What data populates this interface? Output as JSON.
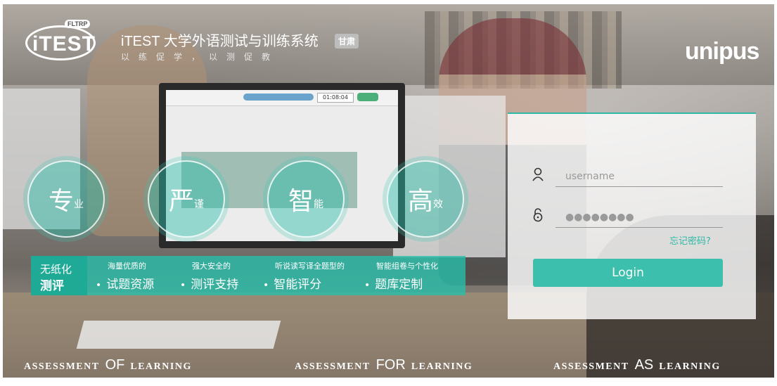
{
  "header": {
    "logo_word": "iTEST",
    "logo_tag": "FLTRP",
    "title": "iTEST 大学外语测试与训练系统",
    "region_badge": "甘肃",
    "slogan": "以练促学，以测促教",
    "brand": "unipus"
  },
  "monitor": {
    "timer": "01:08:04"
  },
  "circles": [
    {
      "big": "专",
      "small": "业"
    },
    {
      "big": "严",
      "small": "谨"
    },
    {
      "big": "智",
      "small": "能"
    },
    {
      "big": "高",
      "small": "效"
    }
  ],
  "feature_bar": {
    "lead_line1": "无纸化",
    "lead_line2": "测评",
    "items": [
      {
        "sub": "海量优质的",
        "main": "试题资源"
      },
      {
        "sub": "强大安全的",
        "main": "测评支持"
      },
      {
        "sub": "听说读写译全题型的",
        "main": "智能评分"
      },
      {
        "sub": "智能组卷与个性化",
        "main": "题库定制"
      }
    ]
  },
  "login": {
    "username_placeholder": "username",
    "password_placeholder": "●●●●●●●●",
    "forgot": "忘记密码?",
    "button": "Login"
  },
  "footer": {
    "slogans": [
      {
        "pre": "ASSESSMENT",
        "key": "OF",
        "post": "LEARNING"
      },
      {
        "pre": "ASSESSMENT",
        "key": "FOR",
        "post": "LEARNING"
      },
      {
        "pre": "ASSESSMENT",
        "key": "AS",
        "post": "LEARNING"
      }
    ]
  }
}
